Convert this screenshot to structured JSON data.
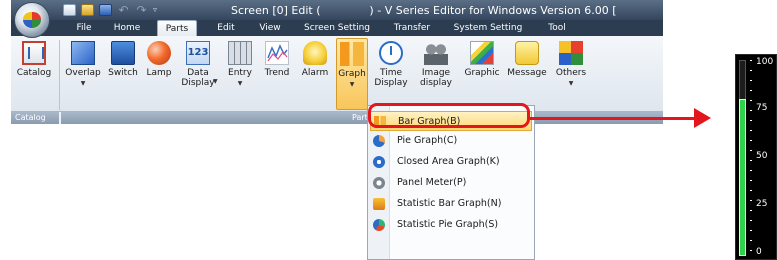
{
  "window": {
    "title": "Screen [0] Edit (              ) - V Series Editor for Windows Version 6.00 [",
    "quick_access": [
      "new-icon",
      "open-folder-icon",
      "save-icon",
      "undo-icon",
      "redo-icon",
      "customize-dropdown-icon"
    ]
  },
  "tabs": [
    {
      "label": "File",
      "active": false
    },
    {
      "label": "Home",
      "active": false
    },
    {
      "label": "Parts",
      "active": true
    },
    {
      "label": "Edit",
      "active": false
    },
    {
      "label": "View",
      "active": false
    },
    {
      "label": "Screen Setting",
      "active": false
    },
    {
      "label": "Transfer",
      "active": false
    },
    {
      "label": "System Setting",
      "active": false
    },
    {
      "label": "Tool",
      "active": false
    }
  ],
  "ribbon": {
    "buttons": [
      {
        "label": "Catalog",
        "icon": "catalog-icon",
        "dropdown": false
      },
      {
        "label": "Overlap",
        "icon": "overlap-icon",
        "dropdown": true
      },
      {
        "label": "Switch",
        "icon": "switch-icon",
        "dropdown": false
      },
      {
        "label": "Lamp",
        "icon": "lamp-icon",
        "dropdown": false
      },
      {
        "label": "Data",
        "label2": "Display",
        "icon": "data-display-icon",
        "icon_text": "123",
        "dropdown": true
      },
      {
        "label": "Entry",
        "icon": "entry-icon",
        "dropdown": true
      },
      {
        "label": "Trend",
        "icon": "trend-icon",
        "dropdown": false
      },
      {
        "label": "Alarm",
        "icon": "alarm-icon",
        "dropdown": false
      },
      {
        "label": "Graph",
        "icon": "graph-icon",
        "dropdown": true,
        "selected": true
      },
      {
        "label": "Time",
        "label2": "Display",
        "icon": "time-display-icon",
        "dropdown": true
      },
      {
        "label": "Image",
        "label2": "display",
        "icon": "image-display-icon",
        "dropdown": true
      },
      {
        "label": "Graphic",
        "icon": "graphic-icon",
        "dropdown": false
      },
      {
        "label": "Message",
        "icon": "message-icon",
        "dropdown": false
      },
      {
        "label": "Others",
        "icon": "others-icon",
        "dropdown": true
      }
    ],
    "group_catalog": "Catalog",
    "group_parts": "Parts"
  },
  "graph_menu": [
    {
      "label": "Bar Graph(B)",
      "icon": "bar-graph-icon",
      "highlighted": true
    },
    {
      "label": "Pie Graph(C)",
      "icon": "pie-graph-icon",
      "highlighted": false
    },
    {
      "label": "Closed Area Graph(K)",
      "icon": "closed-area-graph-icon",
      "highlighted": false
    },
    {
      "label": "Panel Meter(P)",
      "icon": "panel-meter-icon",
      "highlighted": false
    },
    {
      "label": "Statistic Bar Graph(N)",
      "icon": "statistic-bar-graph-icon",
      "highlighted": false
    },
    {
      "label": "Statistic Pie Graph(S)",
      "icon": "statistic-pie-graph-icon",
      "highlighted": false
    }
  ],
  "preview": {
    "ticks": [
      "100",
      "75",
      "50",
      "25",
      "0"
    ],
    "level": 0.8
  },
  "colors": {
    "title_bar": "#34465d",
    "highlight_ring": "#e3151d",
    "menu_highlight": "#ffd770",
    "preview_bar": "#2fd24a"
  }
}
